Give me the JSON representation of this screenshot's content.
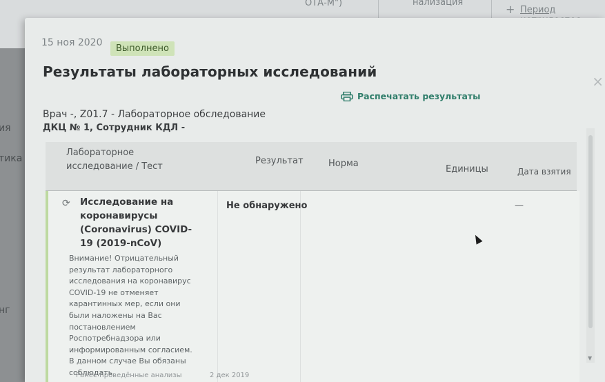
{
  "background": {
    "topbar_left": "ОТА-М\")",
    "topbar_middle": "нализация",
    "topbar_right_plus": "+",
    "topbar_right_link": "Период нетрудоспос",
    "side_texts": [
      "ия",
      "тика",
      "нг"
    ]
  },
  "modal": {
    "date": "15 ноя 2020",
    "status": "Выполнено",
    "title": "Результаты лабораторных исследований",
    "print_label": "Распечатать результаты",
    "close_glyph": "×",
    "meta_line1": "Врач -, Z01.7 - Лабораторное обследование",
    "meta_line2": "ДКЦ № 1, Сотрудник КДЛ -"
  },
  "table": {
    "headers": {
      "test": "Лабораторное исследование / Тест",
      "result": "Результат",
      "norm": "Норма",
      "units": "Единицы",
      "date": "Дата взятия"
    },
    "rows": [
      {
        "name": "Исследование на коронавирусы (Coronavirus) COVID-19 (2019-nCoV)",
        "note": "Внимание! Отрицательный результат лабораторного исследования на коронавирус COVID-19 не отменяет карантинных мер, если они были наложены на Вас постановлением Роспотребнадзора или информированным согласием. В данном случае Вы обязаны соблюдать",
        "result": "Не обнаружено",
        "date": "—"
      }
    ],
    "footer_faded_left": "Ранее проведённые анализы",
    "footer_faded_right": "2 дек 2019"
  },
  "colors": {
    "accent": "#2f7d6a",
    "status_badge_bg": "#cfe3b8",
    "row_marker": "#bdd9a0"
  },
  "icons": {
    "print": "printer-icon",
    "close": "close-icon",
    "row": "refresh-icon"
  }
}
